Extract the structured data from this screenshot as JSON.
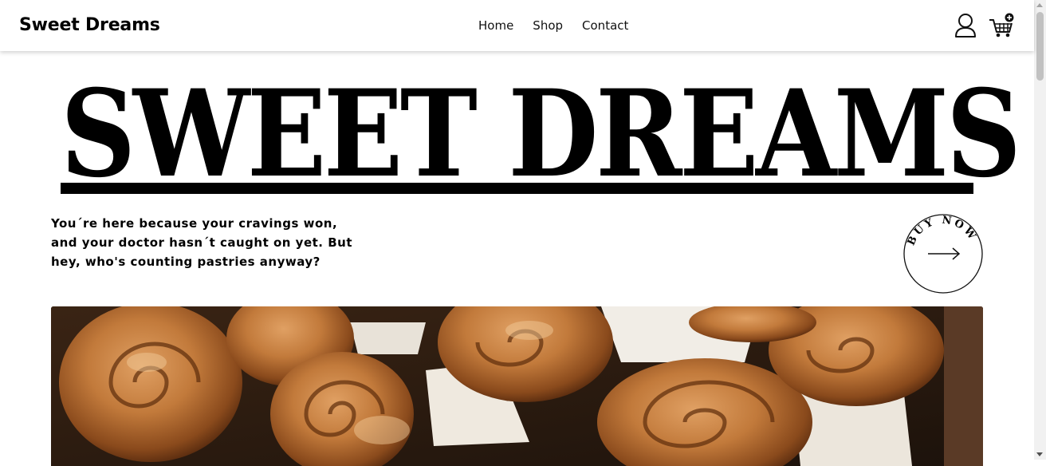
{
  "header": {
    "brand": "Sweet Dreams",
    "nav": [
      {
        "label": "Home"
      },
      {
        "label": "Shop"
      },
      {
        "label": "Contact"
      }
    ],
    "icons": [
      "user-icon",
      "cart-add-icon"
    ]
  },
  "hero": {
    "title": "SWEET DREAMS",
    "tagline": " You´re here because your cravings won, and your doctor hasn´t caught on yet. But hey, who's counting pastries anyway?",
    "cta_circle_text": "BUY NOW",
    "cta_icon": "arrow-right-icon",
    "image": "cinnamon-rolls-photo"
  }
}
